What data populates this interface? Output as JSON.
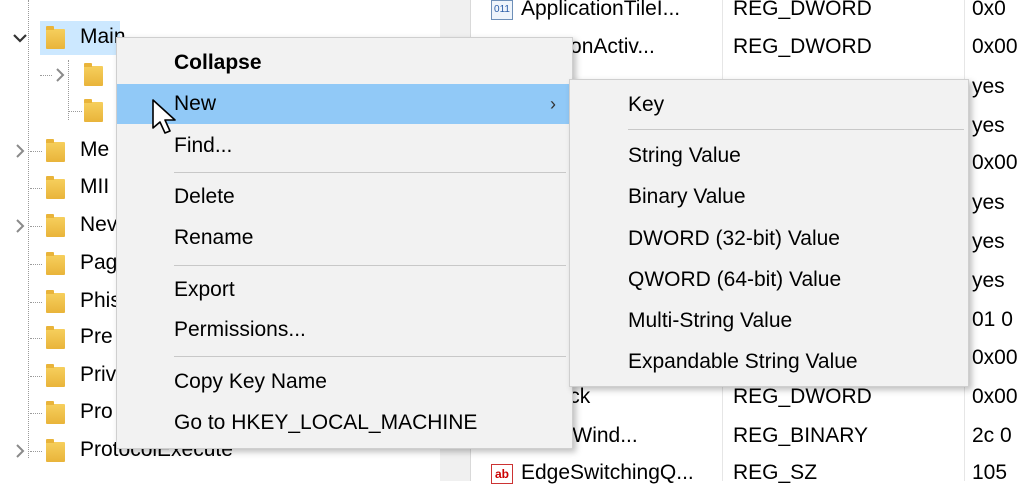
{
  "tree": {
    "items": [
      {
        "label": "Main",
        "expanded": true
      },
      {
        "label": ""
      },
      {
        "label": ""
      },
      {
        "label": "Me"
      },
      {
        "label": "MII"
      },
      {
        "label": "Nev"
      },
      {
        "label": "Pag"
      },
      {
        "label": "Phis"
      },
      {
        "label": "Pre"
      },
      {
        "label": "Priv"
      },
      {
        "label": "Pro"
      },
      {
        "label": "ProtocolExecute"
      }
    ]
  },
  "values": {
    "rows": [
      {
        "name": "ApplicationTileI...",
        "type": "REG_DWORD",
        "data": "0x0",
        "icon": "reg-binary-icon"
      },
      {
        "name": "ociationActiv...",
        "type": "REG_DWORD",
        "data": "0x00",
        "icon": "reg-binary-icon"
      },
      {
        "name": "",
        "type": "",
        "data": "yes",
        "icon": ""
      },
      {
        "name": "",
        "type": "",
        "data": "yes",
        "icon": ""
      },
      {
        "name": "",
        "type": "",
        "data": "0x00",
        "icon": ""
      },
      {
        "name": "",
        "type": "",
        "data": "yes",
        "icon": ""
      },
      {
        "name": "",
        "type": "",
        "data": "yes",
        "icon": ""
      },
      {
        "name": "",
        "type": "",
        "data": "yes",
        "icon": ""
      },
      {
        "name": "",
        "type": "",
        "data": "01 0",
        "icon": ""
      },
      {
        "name": "",
        "type": "",
        "data": "0x00",
        "icon": ""
      },
      {
        "name": "otTrack",
        "type": "REG_DWORD",
        "data": "0x00",
        "icon": ""
      },
      {
        "name": "nloadWind...",
        "type": "REG_BINARY",
        "data": "2c 0",
        "icon": ""
      },
      {
        "name": "EdgeSwitchingQ...",
        "type": "REG_SZ",
        "data": "105",
        "icon": "reg-string-icon"
      }
    ]
  },
  "context_menu": {
    "items": [
      {
        "label": "Collapse",
        "bold": true
      },
      {
        "label": "New",
        "highlighted": true,
        "submenu_arrow": "›"
      },
      {
        "label": "Find..."
      },
      {
        "label": "Delete"
      },
      {
        "label": "Rename"
      },
      {
        "label": "Export"
      },
      {
        "label": "Permissions..."
      },
      {
        "label": "Copy Key Name"
      },
      {
        "label": "Go to HKEY_LOCAL_MACHINE"
      }
    ]
  },
  "submenu": {
    "items": [
      {
        "label": "Key"
      },
      {
        "label": "String Value"
      },
      {
        "label": "Binary Value"
      },
      {
        "label": "DWORD (32-bit) Value"
      },
      {
        "label": "QWORD (64-bit) Value"
      },
      {
        "label": "Multi-String Value"
      },
      {
        "label": "Expandable String Value"
      }
    ]
  },
  "icons": {
    "regbin_glyph": "011",
    "regsz_glyph": "ab"
  },
  "colors": {
    "highlight": "#91c9f7",
    "selection": "#cce8ff",
    "menu_bg": "#f2f2f2",
    "folder": "#f6cf5d"
  }
}
